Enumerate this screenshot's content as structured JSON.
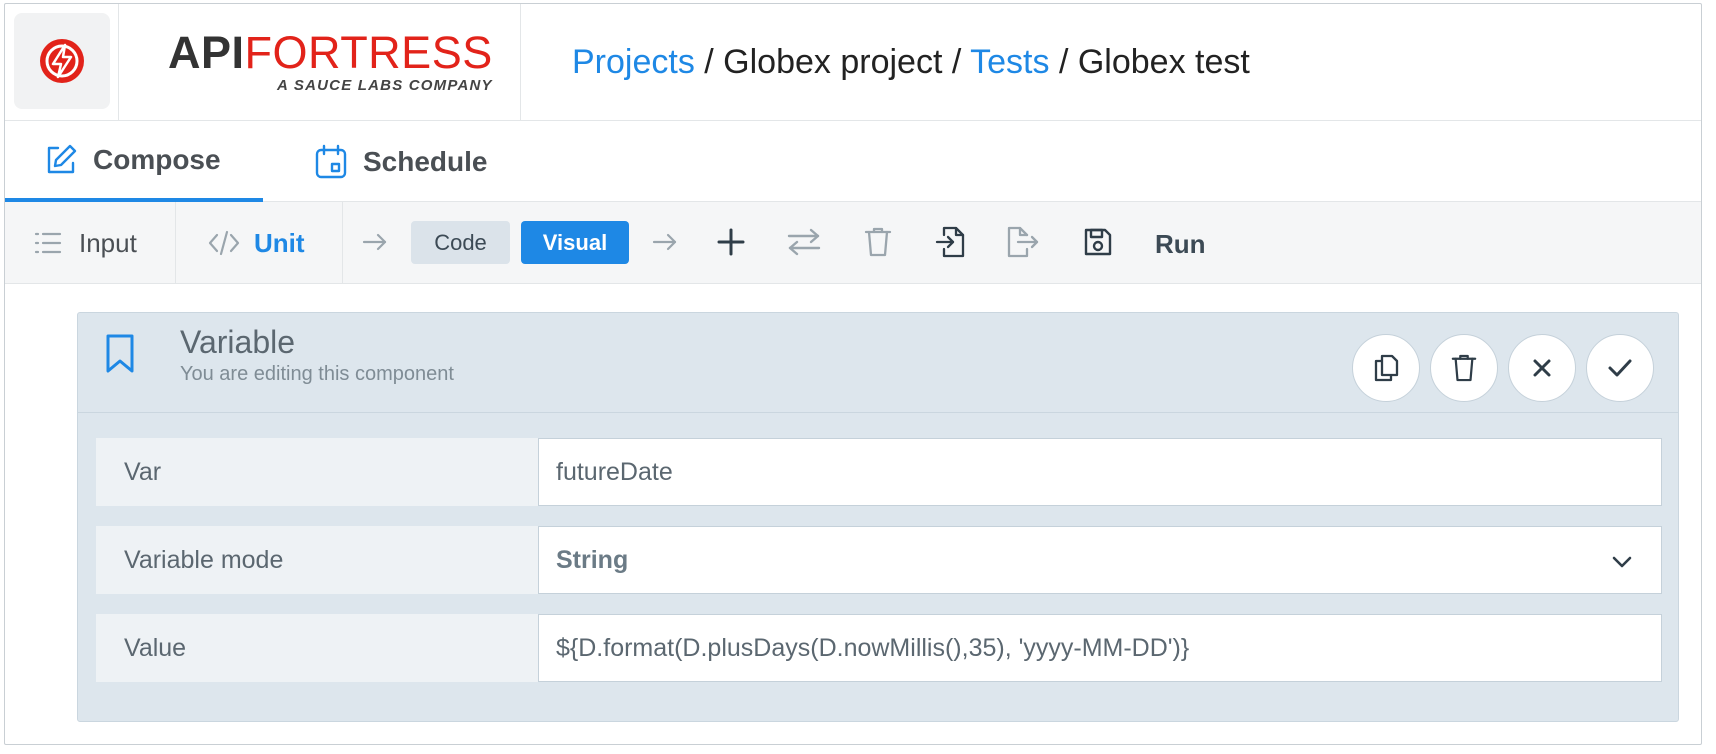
{
  "header": {
    "brand_api": "API",
    "brand_fortress": "FORTRESS",
    "brand_subtitle": "A SAUCE LABS COMPANY",
    "breadcrumb": {
      "projects": "Projects",
      "project_name": "Globex project",
      "tests": "Tests",
      "test_name": "Globex test",
      "separator": " / "
    }
  },
  "tabs": {
    "compose": "Compose",
    "schedule": "Schedule"
  },
  "toolbar": {
    "input": "Input",
    "unit": "Unit",
    "code": "Code",
    "visual": "Visual",
    "run": "Run"
  },
  "component": {
    "title": "Variable",
    "subtitle": "You are editing this component",
    "fields": {
      "var_label": "Var",
      "var_value": "futureDate",
      "mode_label": "Variable mode",
      "mode_value": "String",
      "value_label": "Value",
      "value_value": "${D.format(D.plusDays(D.nowMillis(),35), 'yyyy-MM-DD')}"
    }
  },
  "colors": {
    "accent": "#1e88e5",
    "brand_red": "#e2231a",
    "panel_bg": "#dde6ed"
  },
  "icons": {
    "logo": "lightning-bolt-icon",
    "compose": "edit-icon",
    "schedule": "calendar-icon",
    "input": "list-icon",
    "unit": "code-icon",
    "add": "plus-icon",
    "swap": "swap-icon",
    "delete": "trash-icon",
    "import": "import-icon",
    "export": "export-icon",
    "save": "save-icon",
    "bookmark": "bookmark-icon",
    "copy": "copy-icon",
    "close": "close-icon",
    "confirm": "check-icon",
    "dropdown": "chevron-down-icon"
  }
}
